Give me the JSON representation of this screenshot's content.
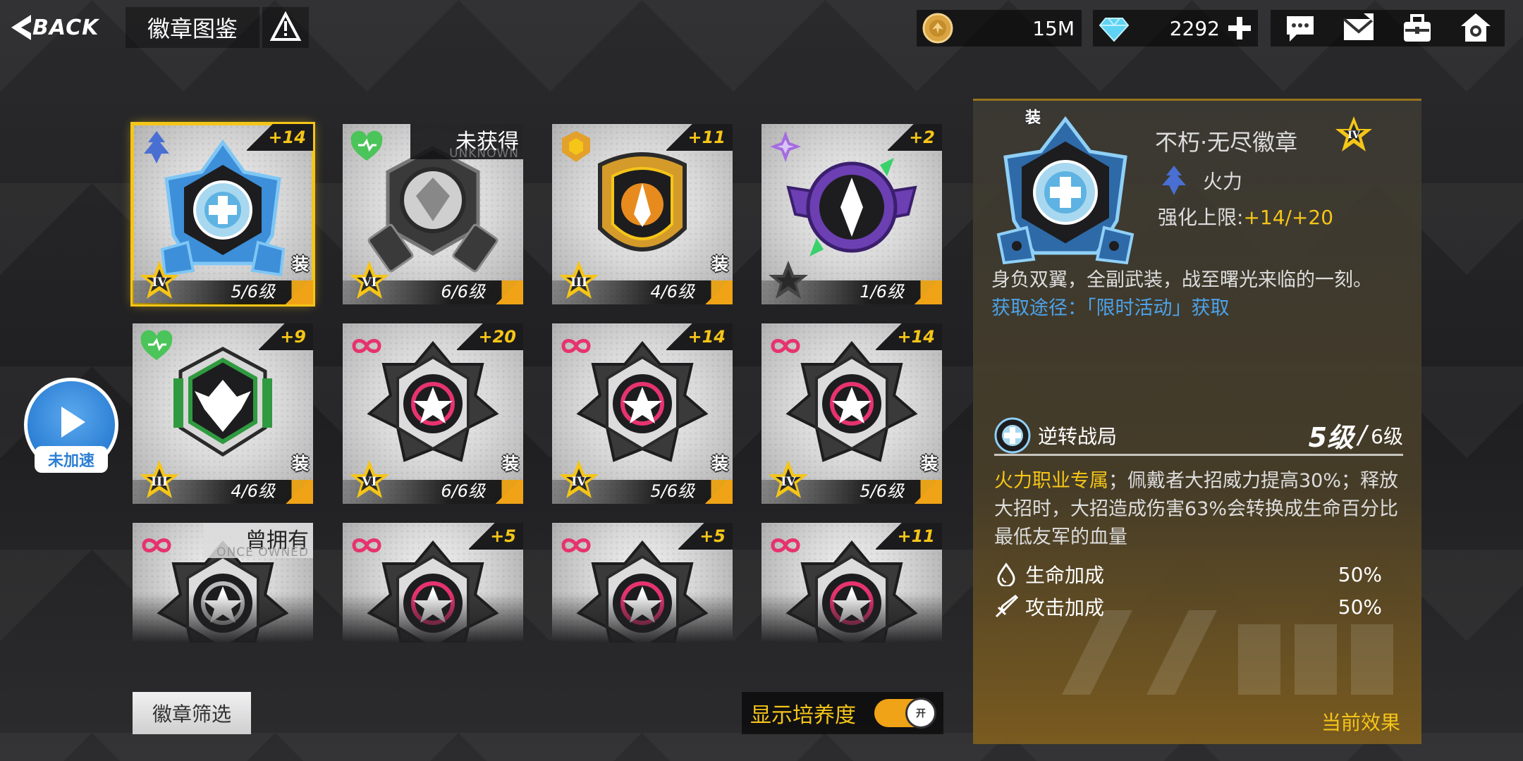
{
  "header": {
    "back_label": "BACK",
    "title": "徽章图鉴",
    "coins": "15M",
    "gems": "2292"
  },
  "speed": {
    "label": "未加速"
  },
  "filter": {
    "label": "徽章筛选"
  },
  "toggle": {
    "label": "显示培养度",
    "knob": "开"
  },
  "badges": [
    {
      "bonus": "+14",
      "level": "5/6级",
      "rank": "IV",
      "equip": "装",
      "type": "fire",
      "color": "#3d8fd9",
      "accent": "#7fc6f5"
    },
    {
      "bonus": "",
      "level": "6/6级",
      "rank": "VI",
      "equip": "",
      "type": "heal",
      "color": "#555",
      "accent": "#999",
      "status": "未获得",
      "status_sub": "UNKNOWN"
    },
    {
      "bonus": "+11",
      "level": "4/6级",
      "rank": "III",
      "equip": "装",
      "type": "shield",
      "color": "#d49b2b",
      "accent": "#f5c518"
    },
    {
      "bonus": "+2",
      "level": "1/6级",
      "rank": "",
      "equip": "",
      "type": "tech",
      "color": "#6c3fb3",
      "accent": "#39d16b"
    },
    {
      "bonus": "+9",
      "level": "4/6级",
      "rank": "III",
      "equip": "装",
      "type": "heal",
      "color": "#2f9a3f",
      "accent": "#71d86f"
    },
    {
      "bonus": "+20",
      "level": "6/6级",
      "rank": "VI",
      "equip": "装",
      "type": "infinite",
      "color": "#333",
      "accent": "#e6336e"
    },
    {
      "bonus": "+14",
      "level": "5/6级",
      "rank": "IV",
      "equip": "装",
      "type": "infinite",
      "color": "#333",
      "accent": "#e6336e"
    },
    {
      "bonus": "+14",
      "level": "5/6级",
      "rank": "IV",
      "equip": "装",
      "type": "infinite",
      "color": "#333",
      "accent": "#e6336e"
    },
    {
      "bonus": "",
      "level": "",
      "rank": "",
      "equip": "",
      "type": "infinite",
      "color": "#333",
      "accent": "#bbb",
      "status": "曾拥有",
      "status_sub": "ONCE OWNED",
      "partial": true
    },
    {
      "bonus": "+5",
      "level": "",
      "rank": "",
      "equip": "",
      "type": "infinite",
      "color": "#333",
      "accent": "#e6336e",
      "partial": true
    },
    {
      "bonus": "+5",
      "level": "",
      "rank": "",
      "equip": "",
      "type": "infinite",
      "color": "#333",
      "accent": "#e6336e",
      "partial": true
    },
    {
      "bonus": "+11",
      "level": "",
      "rank": "",
      "equip": "",
      "type": "infinite",
      "color": "#333",
      "accent": "#e6336e",
      "partial": true
    }
  ],
  "detail": {
    "equip_mark": "装",
    "name": "不朽·无尽徽章",
    "rank": "IV",
    "class_name": "火力",
    "limit_label": "强化上限:",
    "limit_value": "+14/+20",
    "description": "身负双翼，全副武装，战至曙光来临的一刻。",
    "source": "获取途径：「限时活动」获取",
    "skill_name": "逆转战局",
    "skill_level": "5级",
    "skill_sep": "/",
    "skill_max": "6级",
    "skill_highlight": "火力职业专属",
    "skill_text": "；佩戴者大招威力提高30%；释放大招时，大招造成伤害63%会转换成生命百分比最低友军的血量",
    "stats": [
      {
        "label": "生命加成",
        "value": "50%",
        "icon": "droplet-icon"
      },
      {
        "label": "攻击加成",
        "value": "50%",
        "icon": "sword-icon"
      }
    ],
    "effect_label": "当前效果"
  }
}
